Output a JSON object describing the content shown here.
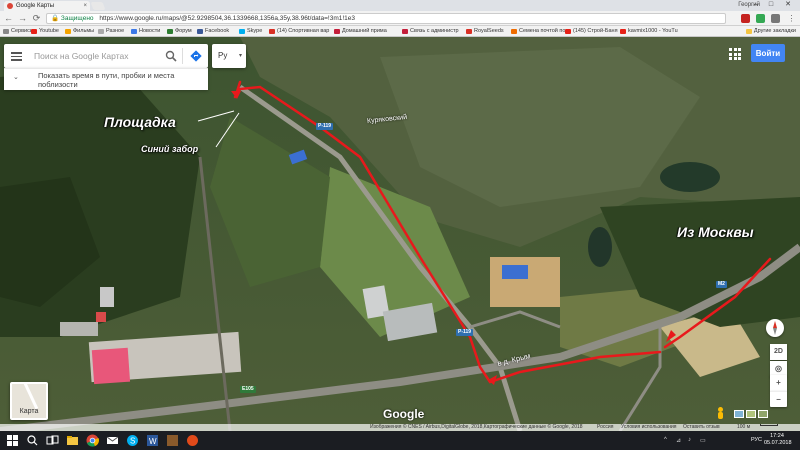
{
  "browser": {
    "tab_title": "Google Карты",
    "tab_close": "×",
    "profile_name": "Георгий",
    "window_controls": [
      "–",
      "□",
      "✕"
    ],
    "nav": {
      "back": "←",
      "forward": "→",
      "reload": "⟳"
    },
    "lock_glyph": "🔒",
    "secure_label": "Защищено",
    "url": "https://www.google.ru/maps/@52.9298504,36.1339668,1356a,35y,38.96t/data=!3m1!1e3",
    "bookmarks": [
      "Сервисы",
      "Youtube",
      "Фильмы",
      "Разное",
      "Новости",
      "Форум",
      "Facebook",
      "Skype",
      "(14) Спортивная вар",
      "Домашний прима",
      "Связь с администр",
      "RoyalSeeds",
      "Семена почтой по",
      "(145) Строй-Баня",
      "kavmix1000 - YouTu"
    ],
    "bookmark_colors": [
      "#888",
      "#e62117",
      "#f4a400",
      "#aaa",
      "#3b78e7",
      "#2e7d32",
      "#3b5998",
      "#00aff0",
      "#d93025",
      "#c41e3a",
      "#c41e3a",
      "#d93025",
      "#ef6c00",
      "#e62117",
      "#e62117"
    ],
    "other_bookmarks": "Другие закладки"
  },
  "map_ui": {
    "search_placeholder": "Поиск на Google Картах",
    "layer_label": "Ру",
    "layer_caret": "▾",
    "nearby_chevron": "⌄",
    "nearby_text": "Показать время в пути, пробки и места поблизости",
    "signin_label": "Войти",
    "zoom_in": "+",
    "zoom_out": "−",
    "view_mode": "2D",
    "locate": "◎",
    "minimap_label": "Карта",
    "google_logo": "Google",
    "attribution": "Изображения © CNES / Airbus,DigitalGlobe, 2018,Картографические данные © Google, 2018",
    "attribution_links": [
      "Россия",
      "Условия использования",
      "Оставить отзыв"
    ],
    "scale_label": "100 м"
  },
  "annotations": {
    "site": "Площадка",
    "fence": "Синий забор",
    "from_moscow": "Из Москвы"
  },
  "map_labels": {
    "village": "Куряковский",
    "crimea_road": "в д. Крым",
    "shield_p119_top": "Р-119",
    "shield_p119_bottom": "Р-119",
    "shield_m2": "М2",
    "shield_e105": "E105"
  },
  "taskbar": {
    "language": "РУС",
    "time": "17:24",
    "date": "05.07.2018",
    "tray_glyphs": [
      "^",
      "⊿",
      "♪",
      "▭"
    ]
  },
  "route_color": "#e8191c"
}
